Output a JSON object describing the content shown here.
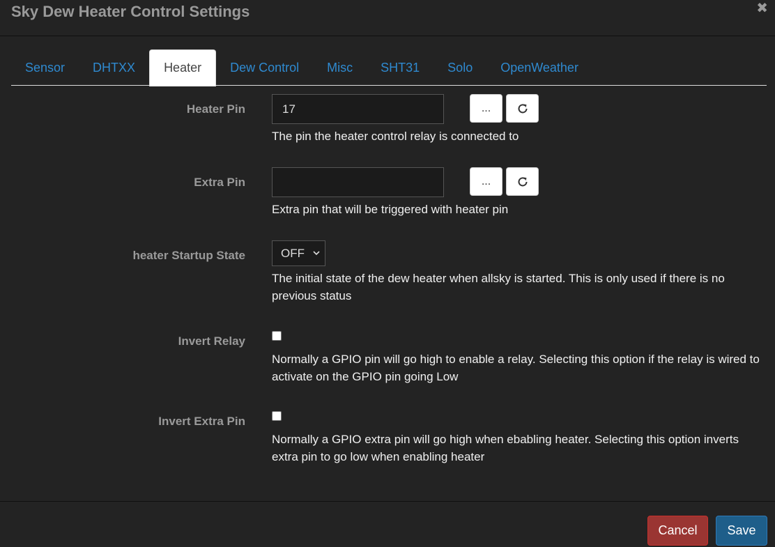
{
  "dialog": {
    "title": "Sky Dew Heater Control Settings",
    "close_symbol": "✖"
  },
  "tabs": [
    {
      "label": "Sensor",
      "active": false
    },
    {
      "label": "DHTXX",
      "active": false
    },
    {
      "label": "Heater",
      "active": true
    },
    {
      "label": "Dew Control",
      "active": false
    },
    {
      "label": "Misc",
      "active": false
    },
    {
      "label": "SHT31",
      "active": false
    },
    {
      "label": "Solo",
      "active": false
    },
    {
      "label": "OpenWeather",
      "active": false
    }
  ],
  "fields": {
    "heater_pin": {
      "label": "Heater Pin",
      "value": "17",
      "help": "The pin the heater control relay is connected to",
      "browse_label": "...",
      "icon": "refresh-icon"
    },
    "extra_pin": {
      "label": "Extra Pin",
      "value": "",
      "help": "Extra pin that will be triggered with heater pin",
      "browse_label": "...",
      "icon": "refresh-icon"
    },
    "startup_state": {
      "label": "heater Startup State",
      "selected": "OFF",
      "help": "The initial state of the dew heater when allsky is started. This is only used if there is no previous status"
    },
    "invert_relay": {
      "label": "Invert Relay",
      "checked": false,
      "help": "Normally a GPIO pin will go high to enable a relay. Selecting this option if the relay is wired to activate on the GPIO pin going Low"
    },
    "invert_extra_pin": {
      "label": "Invert Extra Pin",
      "checked": false,
      "help": "Normally a GPIO extra pin will go high when ebabling heater. Selecting this option inverts extra pin to go low when enabling heater"
    }
  },
  "footer": {
    "cancel_label": "Cancel",
    "save_label": "Save"
  },
  "colors": {
    "background": "#232323",
    "tab_link": "#2f8ad0",
    "cancel": "#9a3532",
    "save": "#1e5e8a"
  }
}
